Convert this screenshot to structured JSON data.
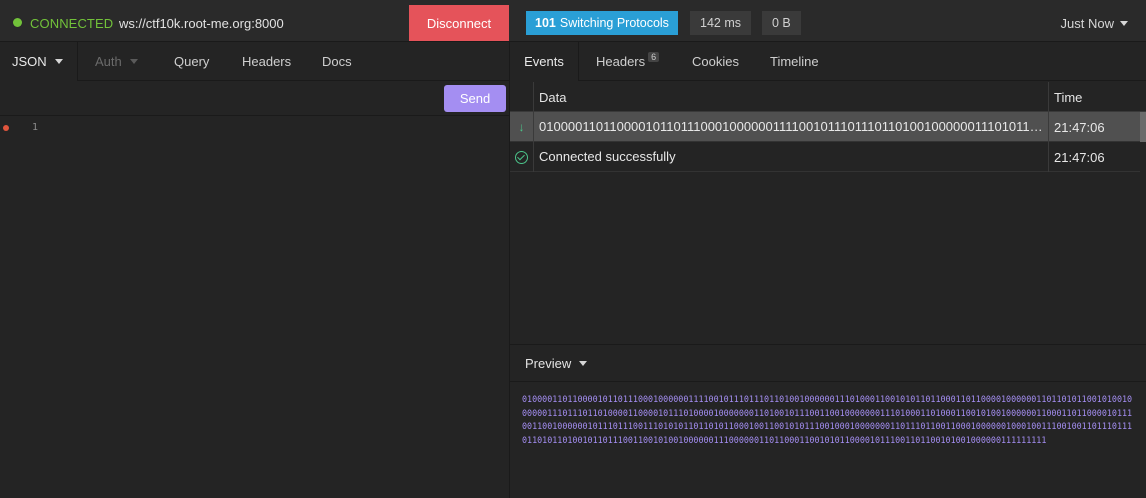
{
  "topbar": {
    "status": "CONNECTED",
    "url": "ws://ctf10k.root-me.org:8000",
    "disconnect_label": "Disconnect",
    "status_code": "101",
    "status_text": "Switching Protocols",
    "timing": "142 ms",
    "size": "0 B",
    "time_filter": "Just Now",
    "colors": {
      "connected": "#72c23a",
      "disconnect": "#e5535a",
      "status_badge": "#2a9fd6"
    }
  },
  "request": {
    "tabs": [
      {
        "label": "JSON",
        "active": true,
        "dropdown": true
      },
      {
        "label": "Auth",
        "disabled": true,
        "dropdown": true
      },
      {
        "label": "Query"
      },
      {
        "label": "Headers"
      },
      {
        "label": "Docs"
      }
    ],
    "send_label": "Send",
    "editor": {
      "line_numbers": [
        "1"
      ],
      "content": ""
    },
    "colors": {
      "send": "#a48ef2"
    }
  },
  "response": {
    "tabs": [
      {
        "label": "Events",
        "active": true
      },
      {
        "label": "Headers",
        "count": "6"
      },
      {
        "label": "Cookies"
      },
      {
        "label": "Timeline"
      }
    ],
    "table": {
      "columns": [
        "Data",
        "Time"
      ],
      "rows": [
        {
          "icon": "arrow-down-icon",
          "data": "01000011011000010110111000100000011110010111011101101001000000111010110100100000011101",
          "time": "21:47:06",
          "selected": true
        },
        {
          "icon": "check-circle-icon",
          "data": "Connected successfully",
          "time": "21:47:06",
          "selected": false
        }
      ]
    },
    "preview": {
      "label": "Preview",
      "content": "01000011011000010110111000100000011110010111011101101001000000111010001100101011011000110110000100000011011010110010100100000011101110110100001100001011101000010000000110100101110011001000000011101000110100011001010010000001100011011000010111001100100000010111011100111010101101101011000100110010101110010001000000011011101100110001000000100010011100100110111011101101011010010110111001100101001000000111000000110110001100101011000010111001101100101001000000111111111"
    }
  }
}
